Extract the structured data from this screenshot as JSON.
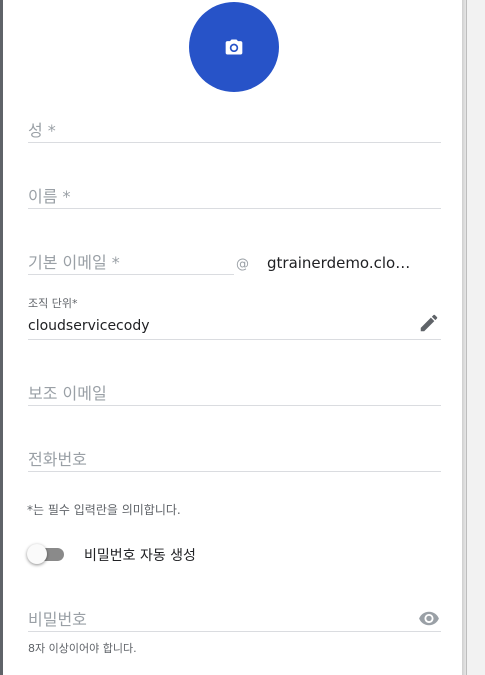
{
  "form": {
    "last_name_placeholder": "성 *",
    "first_name_placeholder": "이름 *",
    "primary_email_placeholder": "기본 이메일 *",
    "at_symbol": "@",
    "domain": "gtrainerdemo.clou…",
    "org_unit_label": "조직 단위*",
    "org_unit_value": "cloudservicecody",
    "secondary_email_placeholder": "보조 이메일",
    "phone_placeholder": "전화번호",
    "required_note": "*는 필수 입력란을 의미합니다.",
    "auto_password_label": "비밀번호 자동 생성",
    "auto_password_on": false,
    "password_placeholder": "비밀번호",
    "password_hint": "8자 이상이어야 합니다."
  },
  "icons": {
    "avatar": "camera-icon",
    "org_edit": "pencil-icon",
    "password_toggle": "eye-icon"
  },
  "colors": {
    "accent": "#2753c8",
    "divider": "#dadce0",
    "placeholder": "#9aa0a6"
  }
}
